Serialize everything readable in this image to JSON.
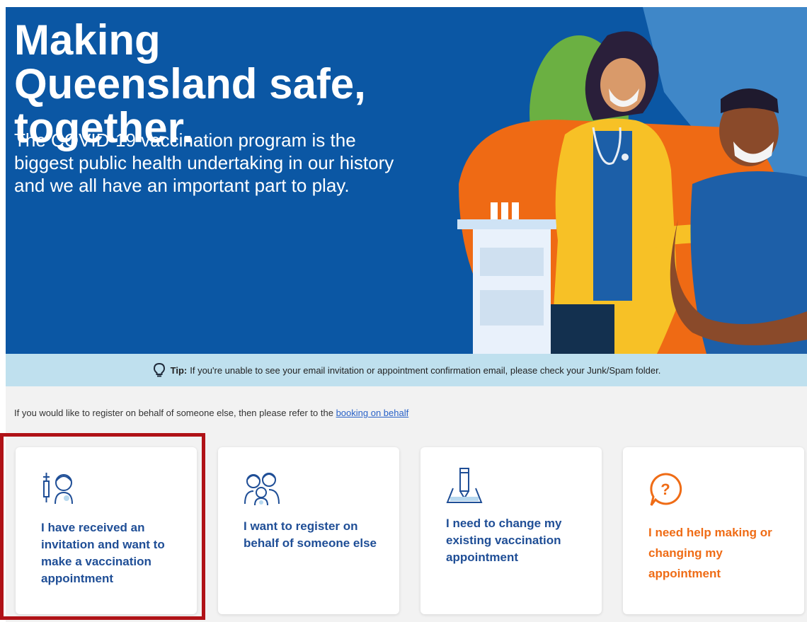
{
  "hero": {
    "title": "Making Queensland safe, together.",
    "subtitle": "The COVID-19 vaccination program is the biggest public health undertaking in our history and we all have an important part to play.",
    "background_color": "#0b57a4"
  },
  "tip": {
    "icon": "lightbulb-icon",
    "label": "Tip:",
    "text": "If you're unable to see your email invitation or appointment confirmation email, please check your Junk/Spam folder."
  },
  "behalf_notice": {
    "text": "If you would like to register on behalf of someone else, then please refer to the",
    "link_text": "booking on behalf"
  },
  "cards": [
    {
      "icon": "vaccination-person-icon",
      "label": "I have received an invitation and want to make a vaccination appointment",
      "highlighted": true
    },
    {
      "icon": "family-icon",
      "label": "I want to register on behalf of someone else"
    },
    {
      "icon": "pencil-edit-icon",
      "label": "I need to change my existing vaccination appointment"
    },
    {
      "icon": "help-question-icon",
      "label": "I need help making or changing my appointment"
    }
  ],
  "colors": {
    "card_text": "#1f4e96",
    "help_text": "#ef6c16",
    "tip_background": "#bfe0ee",
    "highlight_border": "#b01217"
  }
}
